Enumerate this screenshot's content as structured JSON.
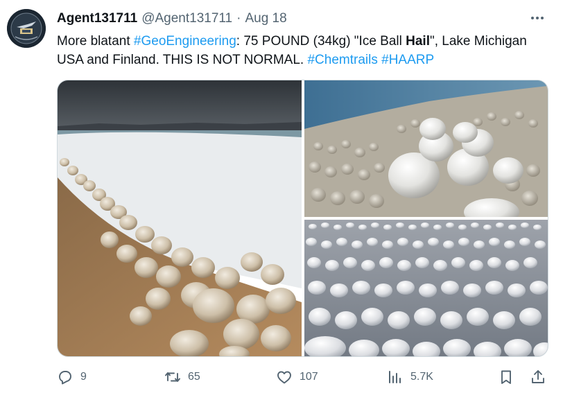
{
  "tweet": {
    "author_name": "Agent131711",
    "author_handle": "@Agent131711",
    "separator": "·",
    "date": "Aug 18",
    "text": {
      "t1": "More blatant ",
      "tag1": "#GeoEngineering",
      "t2": ": 75 POUND (34kg) \"Ice Ball ",
      "bold": "Hail",
      "t3": "\", Lake Michigan USA and Finland.  THIS IS NOT NORMAL. ",
      "tag2": "#Chemtrails",
      "tag3": "#HAARP"
    }
  },
  "actions": {
    "replies": "9",
    "reposts": "65",
    "likes": "107",
    "views": "5.7K"
  },
  "icons": {
    "more": "more-horizontal-icon",
    "reply": "reply-icon",
    "repost": "repost-icon",
    "like": "heart-icon",
    "views": "views-icon",
    "bookmark": "bookmark-icon",
    "share": "share-icon"
  },
  "colors": {
    "link": "#1d9bf0",
    "secondary": "#536471",
    "text": "#0f1419"
  }
}
